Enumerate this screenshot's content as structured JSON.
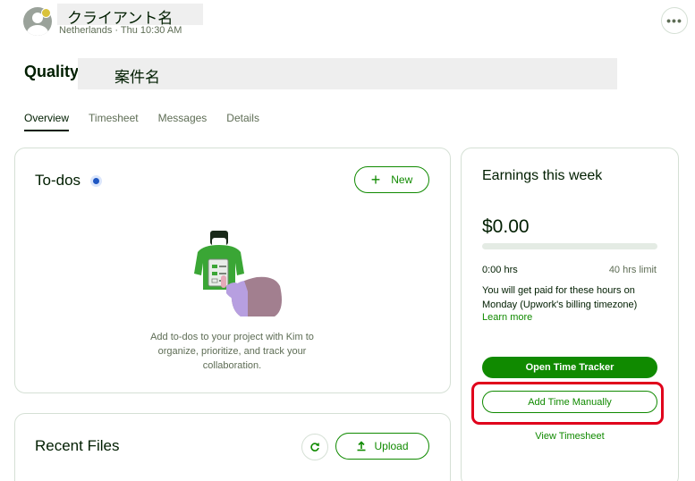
{
  "header": {
    "client_name": "クライアント名",
    "client_meta": "Netherlands · Thu 10:30 AM",
    "more_label": "•••"
  },
  "contract": {
    "prefix": "Quality",
    "title": "案件名"
  },
  "tabs": [
    {
      "label": "Overview",
      "active": true
    },
    {
      "label": "Timesheet",
      "active": false
    },
    {
      "label": "Messages",
      "active": false
    },
    {
      "label": "Details",
      "active": false
    }
  ],
  "todos": {
    "title": "To-dos",
    "new_label": "New",
    "new_icon": "plus-icon",
    "empty_text": "Add to-dos to your project with Kim to organize, prioritize, and track your collaboration."
  },
  "files": {
    "title": "Recent Files",
    "refresh_icon": "refresh-icon",
    "upload_label": "Upload",
    "upload_icon": "upload-icon"
  },
  "earnings": {
    "title": "Earnings this week",
    "amount": "$0.00",
    "progress_fraction": 0,
    "hours_worked": "0:00 hrs",
    "hours_limit": "40 hrs limit",
    "paid_note": "You will get paid for these hours on Monday (Upwork's billing timezone)",
    "learn_more": "Learn more",
    "tracker_button": "Open Time Tracker",
    "manual_button": "Add Time Manually",
    "view_timesheet": "View Timesheet"
  },
  "colors": {
    "brand_green": "#108a00",
    "highlight_red": "#e0001b",
    "notification_blue": "#1f57c3"
  }
}
